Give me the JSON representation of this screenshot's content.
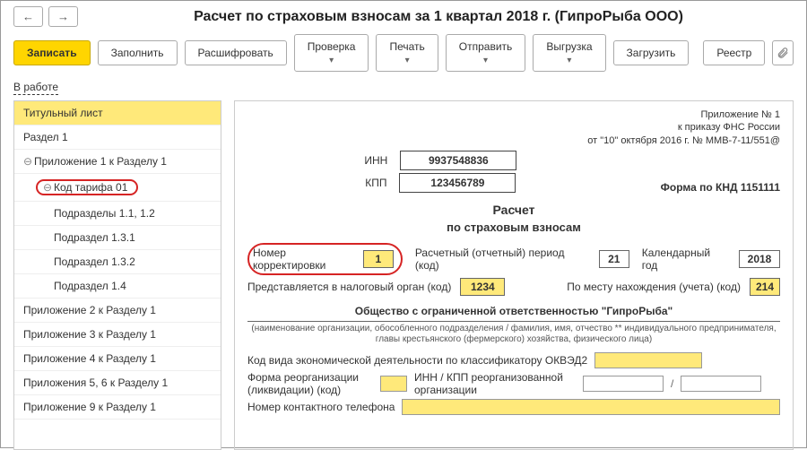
{
  "header": {
    "title": "Расчет по страховым взносам за 1 квартал 2018 г. (ГипроРыба ООО)"
  },
  "toolbar": {
    "write": "Записать",
    "fill": "Заполнить",
    "decrypt": "Расшифровать",
    "check": "Проверка",
    "print": "Печать",
    "send": "Отправить",
    "export": "Выгрузка",
    "import": "Загрузить",
    "registry": "Реестр"
  },
  "status": "В работе",
  "tree": {
    "i0": "Титульный лист",
    "i1": "Раздел 1",
    "i2": "Приложение 1 к Разделу 1",
    "i3": "Код тарифа 01",
    "i4": "Подразделы 1.1, 1.2",
    "i5": "Подраздел 1.3.1",
    "i6": "Подраздел 1.3.2",
    "i7": "Подраздел 1.4",
    "i8": "Приложение 2 к Разделу 1",
    "i9": "Приложение 3 к Разделу 1",
    "i10": "Приложение 4 к Разделу 1",
    "i11": "Приложения 5, 6 к Разделу 1",
    "i12": "Приложение 9 к Разделу 1"
  },
  "form": {
    "appx": "Приложение № 1",
    "order": "к приказу ФНС России",
    "orderdate": "от \"10\" октября 2016 г. № ММВ-7-11/551@",
    "inn_lbl": "ИНН",
    "inn": "9937548836",
    "kpp_lbl": "КПП",
    "kpp": "123456789",
    "knd": "Форма по КНД 1151111",
    "t1": "Расчет",
    "t2": "по страховым взносам",
    "corr_lbl": "Номер корректировки",
    "corr": "1",
    "period_lbl": "Расчетный (отчетный) период (код)",
    "period": "21",
    "year_lbl": "Календарный год",
    "year": "2018",
    "nalog_lbl": "Представляется в налоговый орган (код)",
    "nalog": "1234",
    "place_lbl": "По месту нахождения (учета) (код)",
    "place": "214",
    "org": "Общество с ограниченной ответственностью \"ГипроРыба\"",
    "orgnote": "(наименование организации, обособленного подразделения / фамилия, имя, отчество ** индивидуального предпринимателя, главы крестьянского (фермерского) хозяйства, физического лица)",
    "okved_lbl": "Код вида экономической деятельности по классификатору ОКВЭД2",
    "reorg_lbl": "Форма реорганизации (ликвидации) (код)",
    "reorg_inn_lbl": "ИНН / КПП реорганизованной организации",
    "phone_lbl": "Номер контактного телефона"
  }
}
